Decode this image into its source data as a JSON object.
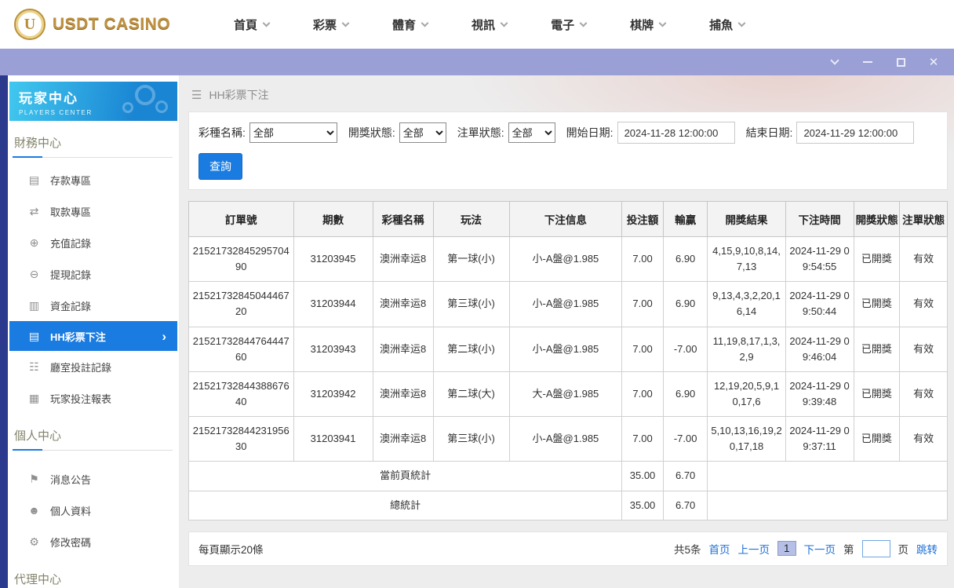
{
  "brand": {
    "name": "USDT CASINO",
    "logo_letter": "U"
  },
  "top_nav": {
    "items": [
      {
        "label": "首頁"
      },
      {
        "label": "彩票"
      },
      {
        "label": "體育"
      },
      {
        "label": "視訊"
      },
      {
        "label": "電子"
      },
      {
        "label": "棋牌"
      },
      {
        "label": "捕魚"
      }
    ]
  },
  "window_controls": {
    "close_glyph": "✕"
  },
  "sidebar": {
    "title": "玩家中心",
    "subtitle": "PLAYERS CENTER",
    "sections": [
      {
        "label": "財務中心",
        "items": [
          {
            "label": "存款專區",
            "glyph": "▤"
          },
          {
            "label": "取款專區",
            "glyph": "⇄"
          },
          {
            "label": "充值記錄",
            "glyph": "⊕"
          },
          {
            "label": "提現記錄",
            "glyph": "⊖"
          },
          {
            "label": "資金記錄",
            "glyph": "▥"
          },
          {
            "label": "HH彩票下注",
            "glyph": "▤",
            "active": true,
            "arrow": "›"
          },
          {
            "label": "廳室投註記錄",
            "glyph": "☷"
          },
          {
            "label": "玩家投注報表",
            "glyph": "▦"
          }
        ]
      },
      {
        "label": "個人中心",
        "items": [
          {
            "label": "消息公告",
            "glyph": "⚑"
          },
          {
            "label": "個人資料",
            "glyph": "☻"
          },
          {
            "label": "修改密碼",
            "glyph": "⚙"
          }
        ]
      },
      {
        "label": "代理中心",
        "items": []
      }
    ]
  },
  "main": {
    "breadcrumb": {
      "menu_glyph": "☰",
      "title": "HH彩票下注"
    },
    "filters": {
      "lottery_label": "彩種名稱:",
      "lottery_value": "全部",
      "draw_status_label": "開獎狀態:",
      "draw_status_value": "全部",
      "order_status_label": "注單狀態:",
      "order_status_value": "全部",
      "start_label": "開始日期:",
      "start_value": "2024-11-28 12:00:00",
      "end_label": "結束日期:",
      "end_value": "2024-11-29 12:00:00",
      "search_button": "查詢"
    },
    "table": {
      "headers": [
        "訂單號",
        "期數",
        "彩種名稱",
        "玩法",
        "下注信息",
        "投注額",
        "輸贏",
        "開獎結果",
        "下注時間",
        "開獎狀態",
        "注單狀態"
      ],
      "rows": [
        {
          "order": "2152173284529570490",
          "period": "31203945",
          "lottery": "澳洲幸运8",
          "play": "第一球(小)",
          "info": "小-A盤@1.985",
          "amount": "7.00",
          "winloss": "6.90",
          "result": "4,15,9,10,8,14,7,13",
          "time": "2024-11-29 09:54:55",
          "draw_status": "已開獎",
          "order_status": "有效"
        },
        {
          "order": "2152173284504446720",
          "period": "31203944",
          "lottery": "澳洲幸运8",
          "play": "第三球(小)",
          "info": "小-A盤@1.985",
          "amount": "7.00",
          "winloss": "6.90",
          "result": "9,13,4,3,2,20,16,14",
          "time": "2024-11-29 09:50:44",
          "draw_status": "已開獎",
          "order_status": "有效"
        },
        {
          "order": "2152173284476444760",
          "period": "31203943",
          "lottery": "澳洲幸运8",
          "play": "第二球(小)",
          "info": "小-A盤@1.985",
          "amount": "7.00",
          "winloss": "-7.00",
          "result": "11,19,8,17,1,3,2,9",
          "time": "2024-11-29 09:46:04",
          "draw_status": "已開獎",
          "order_status": "有效"
        },
        {
          "order": "2152173284438867640",
          "period": "31203942",
          "lottery": "澳洲幸运8",
          "play": "第二球(大)",
          "info": "大-A盤@1.985",
          "amount": "7.00",
          "winloss": "6.90",
          "result": "12,19,20,5,9,10,17,6",
          "time": "2024-11-29 09:39:48",
          "draw_status": "已開獎",
          "order_status": "有效"
        },
        {
          "order": "2152173284423195630",
          "period": "31203941",
          "lottery": "澳洲幸运8",
          "play": "第三球(小)",
          "info": "小-A盤@1.985",
          "amount": "7.00",
          "winloss": "-7.00",
          "result": "5,10,13,16,19,20,17,18",
          "time": "2024-11-29 09:37:11",
          "draw_status": "已開獎",
          "order_status": "有效"
        }
      ],
      "page_total_label": "當前頁統計",
      "page_total_amount": "35.00",
      "page_total_winloss": "6.70",
      "grand_total_label": "總統計",
      "grand_total_amount": "35.00",
      "grand_total_winloss": "6.70"
    },
    "pagination": {
      "per_page": "每頁顯示20條",
      "total": "共5条",
      "first": "首页",
      "prev": "上一页",
      "current_page": "1",
      "next": "下一页",
      "jump_prefix": "第",
      "jump_suffix": "页",
      "jump_button": "跳转"
    }
  },
  "colors": {
    "accent_blue": "#1a7be0",
    "titlebar_purple": "#9aa0d6",
    "left_strip_navy": "#2c3a8e",
    "link_blue": "#1b6fd6",
    "brand_gold": "#bf9140"
  }
}
